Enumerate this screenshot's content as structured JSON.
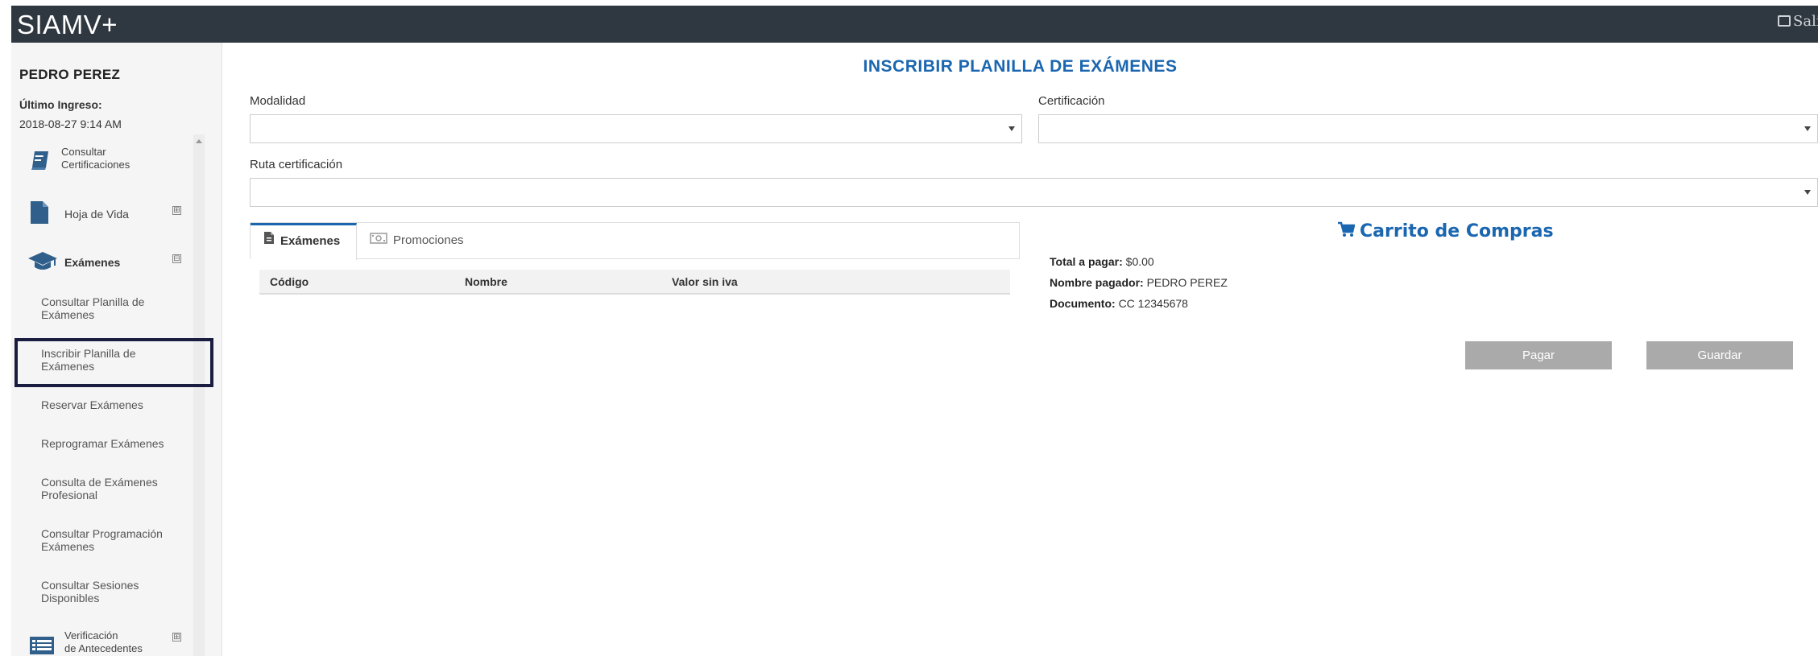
{
  "app": {
    "brand": "SIAMV+",
    "logout_label": "Salir"
  },
  "user": {
    "name": "PEDRO PEREZ",
    "last_login_label": "Último Ingreso:",
    "last_login_value": "2018-08-27 9:14 AM"
  },
  "sidebar": {
    "items": [
      {
        "label_line1": "Consultar",
        "label_line2": "Certificaciones",
        "icon": "book-icon"
      },
      {
        "label": "Hoja de Vida",
        "icon": "document-icon",
        "expander": "⊞"
      },
      {
        "label": "Exámenes",
        "icon": "graduation-cap-icon",
        "expander": "⊟"
      },
      {
        "label_line1": "Verificación",
        "label_line2": "de Antecedentes",
        "icon": "list-icon",
        "expander": "⊞"
      }
    ],
    "sub_items": [
      {
        "line1": "Consultar Planilla de",
        "line2": "Exámenes"
      },
      {
        "line1": "Inscribir Planilla de",
        "line2": "Exámenes"
      },
      {
        "line1": "Reservar Exámenes",
        "line2": ""
      },
      {
        "line1": "Reprogramar Exámenes",
        "line2": ""
      },
      {
        "line1": "Consulta de Exámenes",
        "line2": "Profesional"
      },
      {
        "line1": "Consultar Programación",
        "line2": "Exámenes"
      },
      {
        "line1": "Consultar Sesiones",
        "line2": "Disponibles"
      }
    ]
  },
  "main": {
    "title": "INSCRIBIR PLANILLA DE EXÁMENES",
    "fields": {
      "modalidad_label": "Modalidad",
      "modalidad_value": "",
      "certificacion_label": "Certificación",
      "certificacion_value": "",
      "ruta_label": "Ruta certificación",
      "ruta_value": ""
    },
    "tabs": [
      {
        "label": "Exámenes",
        "icon": "file-icon",
        "active": true
      },
      {
        "label": "Promociones",
        "icon": "money-icon",
        "active": false
      }
    ],
    "table": {
      "headers": [
        "Código",
        "Nombre",
        "Valor sin iva"
      ]
    },
    "cart": {
      "title": "Carrito de Compras",
      "total_label": "Total a pagar:",
      "total_value": "$0.00",
      "payer_label": "Nombre pagador:",
      "payer_value": "PEDRO PEREZ",
      "doc_label": "Documento:",
      "doc_value": "CC 12345678"
    },
    "buttons": {
      "pay": "Pagar",
      "save": "Guardar"
    }
  },
  "colors": {
    "topbar": "#2f3740",
    "accent": "#1a66b0",
    "button_disabled": "#aaaaaa",
    "highlight_border": "#1a1d3f"
  }
}
